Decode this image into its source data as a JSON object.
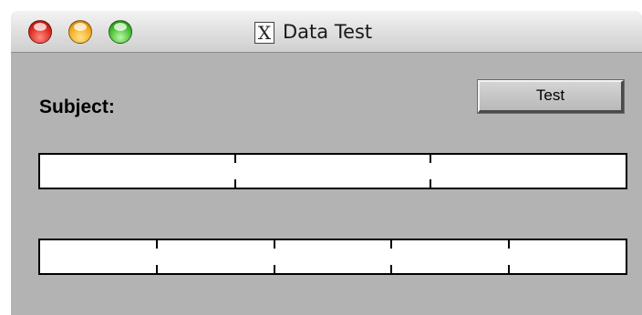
{
  "window": {
    "title": "Data Test",
    "title_icon": "x11-icon",
    "title_icon_glyph": "X",
    "controls": [
      "close",
      "minimize",
      "zoom"
    ]
  },
  "form": {
    "subject_label": "Subject:",
    "test_button_label": "Test"
  },
  "fields": [
    {
      "name": "segmented-field-1",
      "segments": 3
    },
    {
      "name": "segmented-field-2",
      "segments": 5
    }
  ],
  "colors": {
    "window_background": "#b3b3b3",
    "close": "#d8261c",
    "minimize": "#f3a81a",
    "zoom": "#3fb82a"
  }
}
